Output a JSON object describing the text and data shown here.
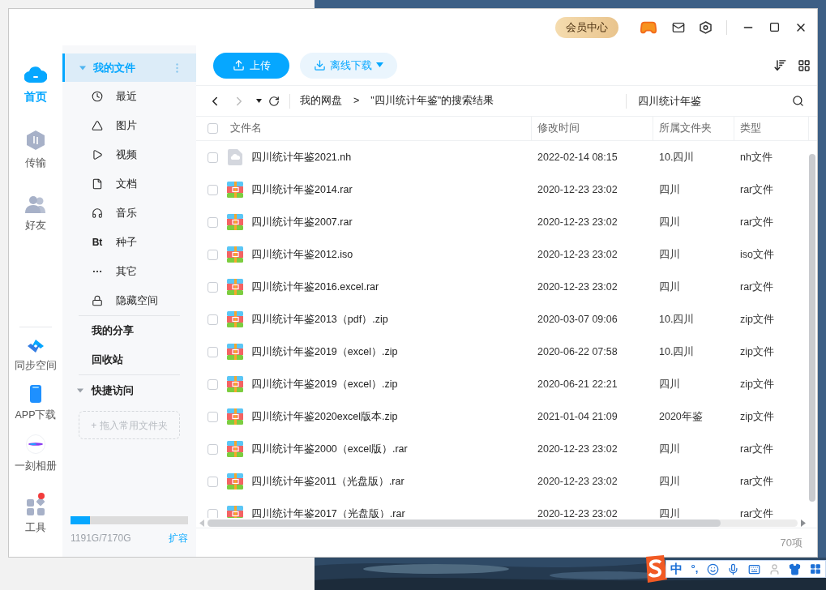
{
  "title_bar": {
    "vip_button": "会员中心"
  },
  "nav_rail": {
    "items": [
      {
        "label": "首页",
        "kind": "home",
        "selected": true,
        "notification": false
      },
      {
        "label": "传输",
        "kind": "transfer",
        "selected": false,
        "notification": false
      },
      {
        "label": "好友",
        "kind": "friends",
        "selected": false,
        "notification": false
      },
      {
        "label": "同步空间",
        "kind": "sync",
        "selected": false,
        "notification": false
      },
      {
        "label": "APP下载",
        "kind": "phone",
        "selected": false,
        "notification": false
      },
      {
        "label": "一刻相册",
        "kind": "album",
        "selected": false,
        "notification": false
      },
      {
        "label": "工具",
        "kind": "tools",
        "selected": false,
        "notification": true
      }
    ]
  },
  "sidebar": {
    "my_files": {
      "label": "我的文件",
      "expanded": true,
      "selected": true
    },
    "categories": [
      {
        "label": "最近",
        "kind": "clock"
      },
      {
        "label": "图片",
        "kind": "mountain"
      },
      {
        "label": "视频",
        "kind": "play"
      },
      {
        "label": "文档",
        "kind": "doc"
      },
      {
        "label": "音乐",
        "kind": "headphones"
      },
      {
        "label": "种子",
        "kind": "glyph",
        "glyph": "Bt"
      },
      {
        "label": "其它",
        "kind": "dots"
      },
      {
        "label": "隐藏空间",
        "kind": "lock"
      }
    ],
    "links": [
      "我的分享",
      "回收站"
    ],
    "quick_access": {
      "label": "快捷访问",
      "expanded": true,
      "drop_hint": "+ 拖入常用文件夹"
    },
    "storage": {
      "level": 0.166,
      "reading": "1191G/7170G",
      "expand_link": "扩容"
    }
  },
  "toolbar": {
    "upload": "上传",
    "offline_download": "离线下载"
  },
  "path_bar": {
    "breadcrumb": [
      "我的网盘",
      "\"四川统计年鉴\"的搜索结果"
    ],
    "separator": ">",
    "search_value": "四川统计年鉴"
  },
  "table": {
    "select_all": false,
    "columns": [
      "文件名",
      "修改时间",
      "所属文件夹",
      "类型"
    ],
    "rows": [
      {
        "name": "四川统计年鉴2021.nh",
        "kind": "cloud",
        "modified": "2022-02-14 08:15",
        "folder": "10.四川",
        "type": "nh文件",
        "checked": false
      },
      {
        "name": "四川统计年鉴2014.rar",
        "kind": "archive",
        "modified": "2020-12-23 23:02",
        "folder": "四川",
        "type": "rar文件",
        "checked": false
      },
      {
        "name": "四川统计年鉴2007.rar",
        "kind": "archive",
        "modified": "2020-12-23 23:02",
        "folder": "四川",
        "type": "rar文件",
        "checked": false
      },
      {
        "name": "四川统计年鉴2012.iso",
        "kind": "archive",
        "modified": "2020-12-23 23:02",
        "folder": "四川",
        "type": "iso文件",
        "checked": false
      },
      {
        "name": "四川统计年鉴2016.excel.rar",
        "kind": "archive",
        "modified": "2020-12-23 23:02",
        "folder": "四川",
        "type": "rar文件",
        "checked": false
      },
      {
        "name": "四川统计年鉴2013（pdf）.zip",
        "kind": "archive",
        "modified": "2020-03-07 09:06",
        "folder": "10.四川",
        "type": "zip文件",
        "checked": false
      },
      {
        "name": "四川统计年鉴2019（excel）.zip",
        "kind": "archive",
        "modified": "2020-06-22 07:58",
        "folder": "10.四川",
        "type": "zip文件",
        "checked": false
      },
      {
        "name": "四川统计年鉴2019（excel）.zip",
        "kind": "archive",
        "modified": "2020-06-21 22:21",
        "folder": "四川",
        "type": "zip文件",
        "checked": false
      },
      {
        "name": "四川统计年鉴2020excel版本.zip",
        "kind": "archive",
        "modified": "2021-01-04 21:09",
        "folder": "2020年鉴",
        "type": "zip文件",
        "checked": false
      },
      {
        "name": "四川统计年鉴2000（excel版）.rar",
        "kind": "archive",
        "modified": "2020-12-23 23:02",
        "folder": "四川",
        "type": "rar文件",
        "checked": false
      },
      {
        "name": "四川统计年鉴2011（光盘版）.rar",
        "kind": "archive",
        "modified": "2020-12-23 23:02",
        "folder": "四川",
        "type": "rar文件",
        "checked": false
      },
      {
        "name": "四川统计年鉴2017（光盘版）.rar",
        "kind": "archive",
        "modified": "2020-12-23 23:02",
        "folder": "四川",
        "type": "rar文件",
        "checked": false
      }
    ]
  },
  "footer": {
    "count": "70项"
  },
  "ime_bar": {
    "mode": "中",
    "punctuation": "°,"
  }
}
